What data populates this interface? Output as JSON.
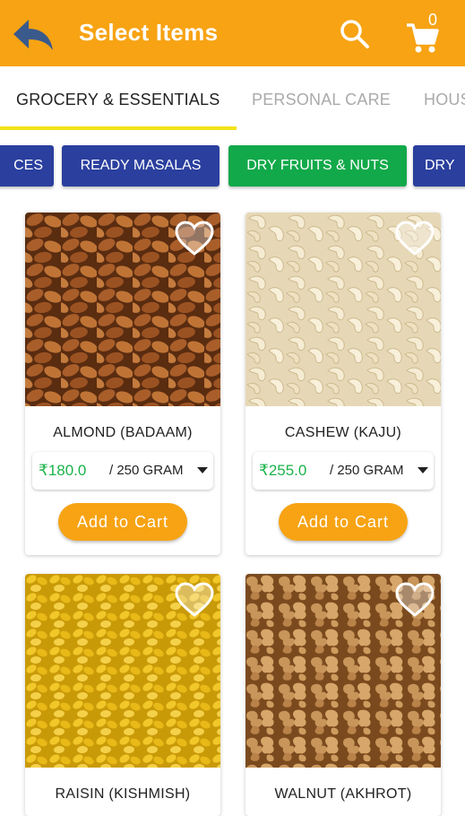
{
  "appbar": {
    "title": "Select Items",
    "cart_count": "0",
    "back_icon": "back-arrow-icon",
    "search_icon": "search-icon",
    "cart_icon": "cart-icon",
    "color": "#f7a313"
  },
  "tabs": [
    {
      "label": "GROCERY & ESSENTIALS",
      "active": true
    },
    {
      "label": "PERSONAL CARE",
      "active": false
    },
    {
      "label": "HOUS",
      "active": false
    }
  ],
  "chips": [
    {
      "label": "CES",
      "color": "#2a3f9e"
    },
    {
      "label": "READY MASALAS",
      "color": "#2a3f9e"
    },
    {
      "label": "DRY FRUITS & NUTS",
      "color": "#12a94a",
      "active": true
    },
    {
      "label": "DRY",
      "color": "#2a3f9e"
    }
  ],
  "products": [
    {
      "name": "ALMOND (BADAAM)",
      "price": "₹180.0",
      "unit": "/ 250 GRAM",
      "add_label": "Add to Cart"
    },
    {
      "name": "CASHEW (KAJU)",
      "price": "₹255.0",
      "unit": "/ 250 GRAM",
      "add_label": "Add to Cart"
    },
    {
      "name": "RAISIN (KISHMISH)"
    },
    {
      "name": "WALNUT (AKHROT)"
    }
  ]
}
